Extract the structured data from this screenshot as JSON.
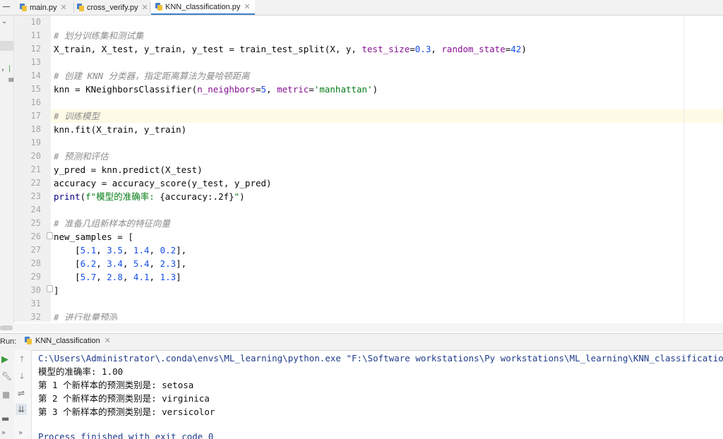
{
  "tabs": [
    {
      "label": "main.py",
      "active": false
    },
    {
      "label": "cross_verify.py",
      "active": false
    },
    {
      "label": "KNN_classification.py",
      "active": true
    }
  ],
  "editor": {
    "line_numbers": [
      "10",
      "11",
      "12",
      "13",
      "14",
      "15",
      "16",
      "17",
      "18",
      "19",
      "20",
      "21",
      "22",
      "23",
      "24",
      "25",
      "26",
      "27",
      "28",
      "29",
      "30",
      "31",
      "32"
    ],
    "current_line": "17",
    "comments": {
      "c11": "# 划分训练集和测试集",
      "c14": "# 创建 KNN 分类器，指定距离算法为曼哈顿距离",
      "c17": "# 训练模型",
      "c20": "# 预测和评估",
      "c25": "# 准备几组新样本的特征向量",
      "c32": "# 进行批量预测"
    },
    "code": {
      "l12a": "X_train, X_test, y_train, y_test = train_test_split(X, y, ",
      "l12b": "test_size",
      "l12c": "=",
      "l12d": "0.3",
      "l12e": ", ",
      "l12f": "random_state",
      "l12g": "=",
      "l12h": "42",
      "l12i": ")",
      "l15a": "knn = KNeighborsClassifier(",
      "l15b": "n_neighbors",
      "l15c": "=",
      "l15d": "5",
      "l15e": ", ",
      "l15f": "metric",
      "l15g": "=",
      "l15h": "'manhattan'",
      "l15i": ")",
      "l18": "knn.fit(X_train, y_train)",
      "l21": "y_pred = knn.predict(X_test)",
      "l22": "accuracy = accuracy_score(y_test, y_pred)",
      "l23a": "print",
      "l23b": "(",
      "l23c": "f\"模型的准确率: ",
      "l23d": "{accuracy:.2f}",
      "l23e": "\"",
      "l23f": ")",
      "l26": "new_samples = [",
      "rows": [
        [
          "5.1",
          "3.5",
          "1.4",
          "0.2"
        ],
        [
          "6.2",
          "3.4",
          "5.4",
          "2.3"
        ],
        [
          "5.7",
          "2.8",
          "4.1",
          "1.3"
        ]
      ],
      "l30": "]"
    }
  },
  "run_panel": {
    "label": "Run:",
    "tab_label": "KNN_classification",
    "output": [
      "C:\\Users\\Administrator\\.conda\\envs\\ML_learning\\python.exe \"F:\\Software workstations\\Py workstations\\ML_learning\\KNN_classification",
      "模型的准确率: 1.00",
      "第 1 个新样本的预测类别是: setosa",
      "第 2 个新样本的预测类别是: virginica",
      "第 3 个新样本的预测类别是: versicolor",
      "",
      "Process finished with exit code 0"
    ]
  },
  "colors": {
    "comment": "#8c8c8c",
    "keyword_arg": "#871094",
    "number": "#1750eb",
    "string": "#067d17",
    "current_line_bg": "#fdfbe6"
  }
}
